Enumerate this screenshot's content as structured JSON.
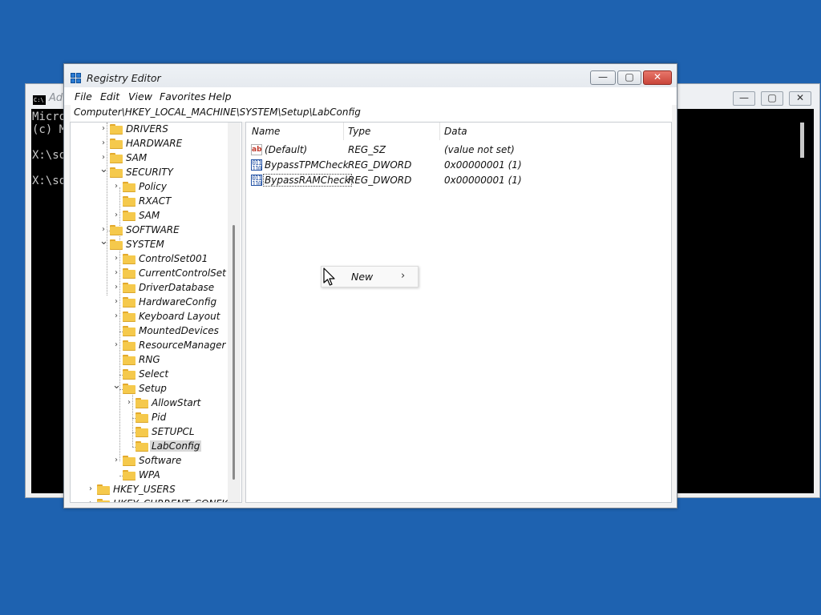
{
  "console": {
    "title": "Ad",
    "icon_text": "C:\\",
    "lines": [
      "Micro",
      "(c) M",
      "",
      "X:\\so",
      "",
      "X:\\so"
    ],
    "minimize": "—",
    "maximize": "▢",
    "close": "✕"
  },
  "regedit": {
    "title": "Registry Editor",
    "menu": [
      "File",
      "Edit",
      "View",
      "Favorites",
      "Help"
    ],
    "address": "Computer\\HKEY_LOCAL_MACHINE\\SYSTEM\\Setup\\LabConfig",
    "buttons": {
      "minimize": "—",
      "maximize": "▢",
      "close": "✕"
    },
    "tree": [
      {
        "label": "DRIVERS",
        "level": 2,
        "expander": "collapsed"
      },
      {
        "label": "HARDWARE",
        "level": 2,
        "expander": "collapsed"
      },
      {
        "label": "SAM",
        "level": 2,
        "expander": "collapsed"
      },
      {
        "label": "SECURITY",
        "level": 2,
        "expander": "expanded"
      },
      {
        "label": "Policy",
        "level": 3,
        "expander": "collapsed"
      },
      {
        "label": "RXACT",
        "level": 3,
        "expander": "none"
      },
      {
        "label": "SAM",
        "level": 3,
        "expander": "collapsed"
      },
      {
        "label": "SOFTWARE",
        "level": 2,
        "expander": "collapsed"
      },
      {
        "label": "SYSTEM",
        "level": 2,
        "expander": "expanded"
      },
      {
        "label": "ControlSet001",
        "level": 3,
        "expander": "collapsed"
      },
      {
        "label": "CurrentControlSet",
        "level": 3,
        "expander": "collapsed"
      },
      {
        "label": "DriverDatabase",
        "level": 3,
        "expander": "collapsed"
      },
      {
        "label": "HardwareConfig",
        "level": 3,
        "expander": "collapsed"
      },
      {
        "label": "Keyboard Layout",
        "level": 3,
        "expander": "collapsed"
      },
      {
        "label": "MountedDevices",
        "level": 3,
        "expander": "none"
      },
      {
        "label": "ResourceManager",
        "level": 3,
        "expander": "collapsed"
      },
      {
        "label": "RNG",
        "level": 3,
        "expander": "none"
      },
      {
        "label": "Select",
        "level": 3,
        "expander": "none"
      },
      {
        "label": "Setup",
        "level": 3,
        "expander": "expanded"
      },
      {
        "label": "AllowStart",
        "level": 4,
        "expander": "collapsed"
      },
      {
        "label": "Pid",
        "level": 4,
        "expander": "none"
      },
      {
        "label": "SETUPCL",
        "level": 4,
        "expander": "none"
      },
      {
        "label": "LabConfig",
        "level": 4,
        "expander": "none",
        "selected": true
      },
      {
        "label": "Software",
        "level": 3,
        "expander": "collapsed"
      },
      {
        "label": "WPA",
        "level": 3,
        "expander": "none"
      },
      {
        "label": "HKEY_USERS",
        "level": 1,
        "expander": "collapsed"
      },
      {
        "label": "HKEY_CURRENT_CONFIG",
        "level": 1,
        "expander": "collapsed"
      }
    ],
    "columns": [
      "Name",
      "Type",
      "Data"
    ],
    "values": [
      {
        "name": "(Default)",
        "type": "REG_SZ",
        "data": "(value not set)",
        "icon": "string-value-icon"
      },
      {
        "name": "BypassTPMCheck",
        "type": "REG_DWORD",
        "data": "0x00000001 (1)",
        "icon": "dword-value-icon"
      },
      {
        "name": "BypassRAMCheck",
        "type": "REG_DWORD",
        "data": "0x00000001 (1)",
        "icon": "dword-value-icon"
      }
    ],
    "context_menu": {
      "items": [
        {
          "label": "New",
          "submenu": true,
          "arrow": "›"
        }
      ]
    }
  },
  "colors": {
    "desktop": "#1e62b0",
    "folder": "#f5c94c",
    "selection": "#d9d9d9",
    "close_button": "#c9453a"
  }
}
